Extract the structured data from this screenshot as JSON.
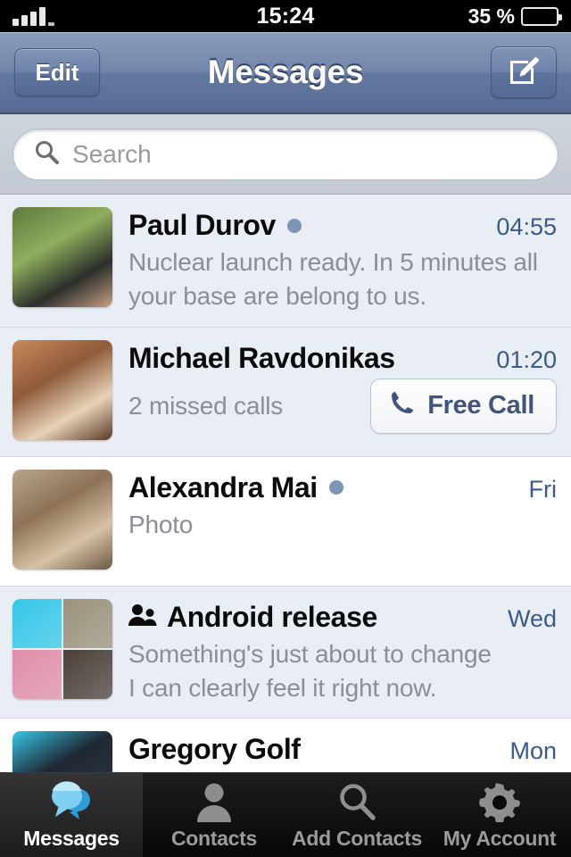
{
  "status_bar": {
    "signal_icon": "signal-bars-icon",
    "signal_bars_filled": 4,
    "time": "15:24",
    "battery_percent_label": "35 %",
    "battery_level": 35,
    "battery_icon": "battery-icon"
  },
  "nav_bar": {
    "edit_label": "Edit",
    "title": "Messages",
    "compose_icon": "compose-pencil-icon"
  },
  "search": {
    "icon": "search-icon",
    "placeholder": "Search",
    "value": ""
  },
  "conversations": [
    {
      "name": "Paul Durov",
      "unread": true,
      "has_dot": true,
      "time": "04:55",
      "preview_lines": [
        "Nuclear launch ready. In 5 minutes all",
        "your base are belong to us."
      ],
      "avatar_type": "photo",
      "avatar_colors": [
        "#5c7a3c",
        "#8fae5e",
        "#2b2f2a",
        "#c79f86"
      ],
      "is_group": false,
      "action_button": null
    },
    {
      "name": "Michael Ravdonikas",
      "unread": true,
      "has_dot": false,
      "time": "01:20",
      "preview_lines": [
        "2 missed calls"
      ],
      "avatar_type": "photo",
      "avatar_colors": [
        "#c88a5e",
        "#8f5b3a",
        "#e7d3b8",
        "#5a3725"
      ],
      "is_group": false,
      "action_button": {
        "label": "Free Call",
        "icon": "phone-icon"
      }
    },
    {
      "name": "Alexandra Mai",
      "unread": false,
      "has_dot": true,
      "time": "Fri",
      "preview_lines": [
        "Photo"
      ],
      "avatar_type": "photo",
      "avatar_colors": [
        "#b9a58c",
        "#8d7257",
        "#d8c2a6",
        "#6b5642"
      ],
      "is_group": false,
      "action_button": null
    },
    {
      "name": "Android release",
      "unread": true,
      "has_dot": false,
      "time": "Wed",
      "preview_lines": [
        "Something's just about to change",
        "I can clearly feel it right now."
      ],
      "avatar_type": "group-grid",
      "avatar_colors": [
        "#35c8e8",
        "#9b9279",
        "#e08fa8",
        "#4a4038"
      ],
      "is_group": true,
      "group_icon": "group-people-icon",
      "action_button": null
    },
    {
      "name": "Gregory Golf",
      "unread": false,
      "has_dot": false,
      "time": "Mon",
      "preview_lines": [],
      "avatar_type": "photo",
      "avatar_colors": [
        "#35c8e8",
        "#1f2733",
        "#2a3340",
        "#48c6e0"
      ],
      "is_group": false,
      "action_button": null
    }
  ],
  "tab_bar": {
    "tabs": [
      {
        "label": "Messages",
        "icon": "chat-bubbles-icon",
        "active": true
      },
      {
        "label": "Contacts",
        "icon": "person-icon",
        "active": false
      },
      {
        "label": "Add Contacts",
        "icon": "search-icon",
        "active": false
      },
      {
        "label": "My Account",
        "icon": "gear-icon",
        "active": false
      }
    ]
  },
  "colors": {
    "nav_bar_top": "#8a9cba",
    "nav_bar_bottom": "#566c95",
    "unread_row_bg": "#e9eef5",
    "read_row_bg": "#ffffff",
    "timestamp": "#3a5a87",
    "unread_dot": "#7e95b8",
    "preview_text": "#8b8f95",
    "tab_active_label": "#ffffff",
    "tab_inactive_label": "#9b9b9b"
  }
}
